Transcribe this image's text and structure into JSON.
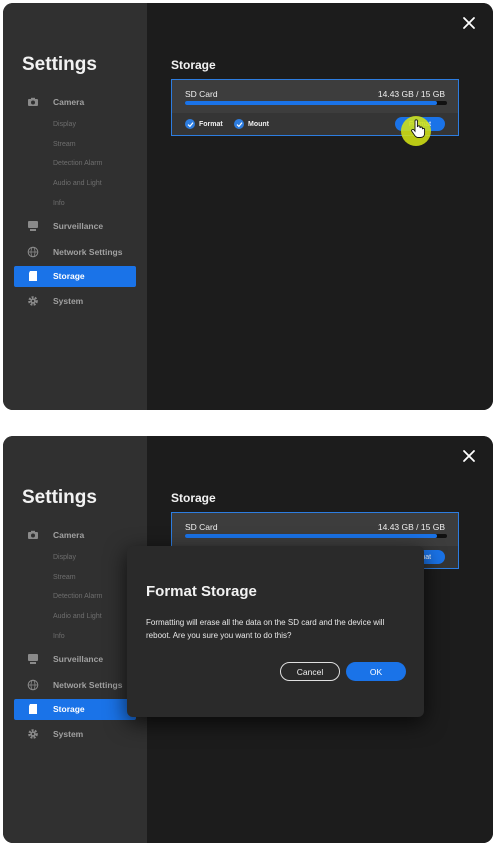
{
  "settings": {
    "title": "Settings",
    "nav": [
      {
        "label": "Camera",
        "icon": "camera-icon",
        "subitems": [
          "Display",
          "Stream",
          "Detection Alarm",
          "Audio and Light",
          "Info"
        ]
      },
      {
        "label": "Surveillance",
        "icon": "surveillance-icon"
      },
      {
        "label": "Network Settings",
        "icon": "globe-icon"
      },
      {
        "label": "Storage",
        "icon": "storage-icon",
        "active": true
      },
      {
        "label": "System",
        "icon": "gear-icon"
      }
    ]
  },
  "storage": {
    "title": "Storage",
    "card_name": "SD Card",
    "card_size": "14.43 GB / 15 GB",
    "usage_fraction": 0.96,
    "format_check_label": "Format",
    "mount_check_label": "Mount",
    "format_button_label": "Format"
  },
  "dialog": {
    "title": "Format Storage",
    "message": "Formatting will erase all the data on the SD card and the device will reboot. Are you sure you want to do this?",
    "cancel_label": "Cancel",
    "ok_label": "OK"
  },
  "colors": {
    "accent": "#1a73e8",
    "cursor_highlight": "#d2e114"
  }
}
